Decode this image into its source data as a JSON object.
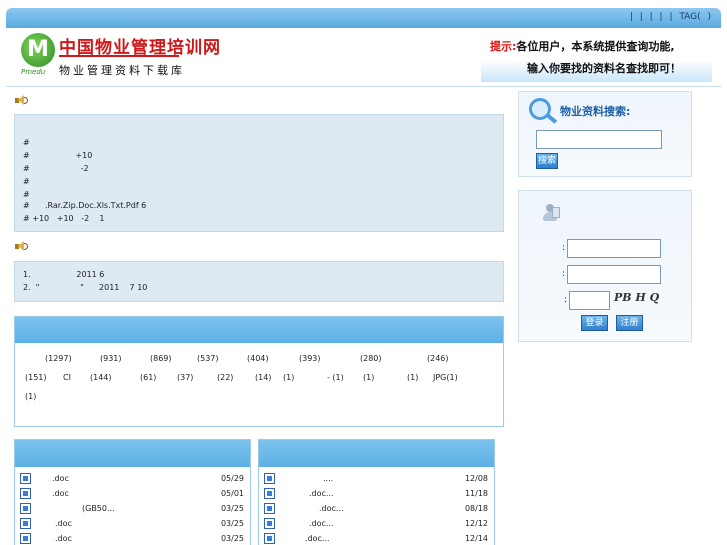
{
  "header": {
    "links": "|  |   |   |  | TAG(  )",
    "logo": {
      "mark": "M",
      "mark_sub": "Pmedu",
      "title": "中国物业管理培训网",
      "subtitle": "物业管理资料下载库"
    },
    "tip": {
      "label": "提示:",
      "line1": "各位用户，本系统提供查询功能,",
      "line2": "输入你要找的资料名查找即可！"
    }
  },
  "notice1": {
    "lines": [
      "#",
      "#                  +10",
      "#                    -2",
      "#",
      "#",
      "#      .Rar.Zip.Doc.Xls.Txt.Pdf 6",
      "# +10   +10   -2    1"
    ]
  },
  "notice2": {
    "lines": [
      "1.                  2011 6",
      "2.  \"                \"      2011    7 10"
    ]
  },
  "categories": {
    "row1": [
      "(1297)",
      "(931)",
      "(869)",
      "(537)",
      "(404)",
      "(393)",
      "(280)",
      "(246)"
    ],
    "row2": [
      "(151)",
      "CI",
      "(144)",
      "(61)",
      "(37)",
      "(22)",
      "(14)",
      "(1)",
      "- (1)",
      "(1)",
      "(1)",
      "JPG(1)"
    ],
    "row3": [
      "(1)"
    ]
  },
  "list_left": [
    {
      "title": ".doc",
      "date": "05/29"
    },
    {
      "title": ".doc",
      "date": "05/01"
    },
    {
      "title": "(GB50...",
      "date": "03/25"
    },
    {
      "title": ".doc",
      "date": "03/25"
    },
    {
      "title": ".doc",
      "date": "03/25"
    }
  ],
  "list_right": [
    {
      "title": "....",
      "date": "12/08"
    },
    {
      "title": ".doc...",
      "date": "11/18"
    },
    {
      "title": ".doc...",
      "date": "08/18"
    },
    {
      "title": ".doc...",
      "date": "12/12"
    },
    {
      "title": ".doc...",
      "date": "12/14"
    }
  ],
  "search": {
    "label": "物业资料搜索:",
    "button": "搜索"
  },
  "login": {
    "colon": ":",
    "captcha": "PB H Q",
    "login_button": "登录",
    "register_button": "注册"
  },
  "colors": {
    "accent_blue": "#5cb0e6",
    "notice_bg": "#dde9f3",
    "tip_red": "#e01010",
    "logo_red": "#d01818",
    "logo_green": "#2f8d22"
  }
}
